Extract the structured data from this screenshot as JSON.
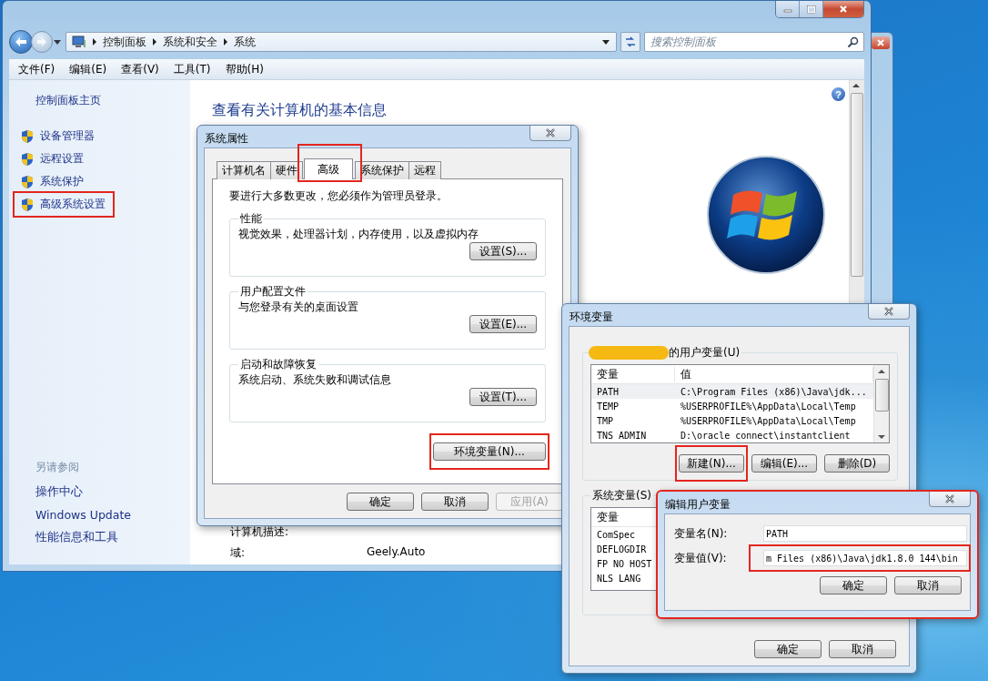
{
  "main_window": {
    "address_bar": {
      "breadcrumb": [
        "控制面板",
        "系统和安全",
        "系统"
      ],
      "search_placeholder": "搜索控制面板"
    },
    "menu": [
      "文件(F)",
      "编辑(E)",
      "查看(V)",
      "工具(T)",
      "帮助(H)"
    ],
    "sidebar": {
      "home": "控制面板主页",
      "items": [
        {
          "label": "设备管理器",
          "highlighted": false
        },
        {
          "label": "远程设置",
          "highlighted": false
        },
        {
          "label": "系统保护",
          "highlighted": false
        },
        {
          "label": "高级系统设置",
          "highlighted": true
        }
      ],
      "see_also_heading": "另请参阅",
      "see_also": [
        "操作中心",
        "Windows Update",
        "性能信息和工具"
      ]
    },
    "content": {
      "heading": "查看有关计算机的基本信息",
      "help_button": "?",
      "rows": [
        {
          "label": "计算机描述:"
        },
        {
          "label": "域:",
          "value": "Geely.Auto"
        }
      ]
    }
  },
  "system_properties": {
    "title": "系统属性",
    "tabs": [
      {
        "label": "计算机名",
        "selected": false,
        "highlighted": false
      },
      {
        "label": "硬件",
        "selected": false,
        "highlighted": false
      },
      {
        "label": "高级",
        "selected": true,
        "highlighted": true
      },
      {
        "label": "系统保护",
        "selected": false,
        "highlighted": false
      },
      {
        "label": "远程",
        "selected": false,
        "highlighted": false
      }
    ],
    "notice": "要进行大多数更改，您必须作为管理员登录。",
    "groups": [
      {
        "title": "性能",
        "description": "视觉效果，处理器计划，内存使用，以及虚拟内存",
        "button": "设置(S)..."
      },
      {
        "title": "用户配置文件",
        "description": "与您登录有关的桌面设置",
        "button": "设置(E)..."
      },
      {
        "title": "启动和故障恢复",
        "description": "系统启动、系统失败和调试信息",
        "button": "设置(T)..."
      }
    ],
    "env_button": {
      "label": "环境变量(N)...",
      "highlighted": true
    },
    "buttons": [
      {
        "label": "确定",
        "disabled": false
      },
      {
        "label": "取消",
        "disabled": false
      },
      {
        "label": "应用(A)",
        "disabled": true
      }
    ]
  },
  "environment_variables": {
    "title": "环境变量",
    "user_vars": {
      "title": "的用户变量(U)",
      "columns": [
        "变量",
        "值"
      ],
      "rows": [
        {
          "name": "PATH",
          "value": "C:\\Program Files (x86)\\Java\\jdk...",
          "selected": true
        },
        {
          "name": "TEMP",
          "value": "%USERPROFILE%\\AppData\\Local\\Temp",
          "selected": false
        },
        {
          "name": "TMP",
          "value": "%USERPROFILE%\\AppData\\Local\\Temp",
          "selected": false
        },
        {
          "name": "TNS_ADMIN",
          "value": "D:\\oracle_connect\\instantclient",
          "selected": false
        }
      ],
      "buttons": [
        {
          "label": "新建(N)...",
          "highlighted": true
        },
        {
          "label": "编辑(E)...",
          "highlighted": false
        },
        {
          "label": "删除(D)",
          "highlighted": false
        }
      ]
    },
    "system_vars": {
      "title": "系统变量(S)",
      "columns": [
        "变量"
      ],
      "rows": [
        {
          "name": "ComSpec"
        },
        {
          "name": "DEFLOGDIR"
        },
        {
          "name": "FP_NO_HOST_"
        },
        {
          "name": "NLS_LANG"
        }
      ]
    },
    "buttons": [
      "确定",
      "取消"
    ]
  },
  "edit_dialog": {
    "title": "编辑用户变量",
    "highlighted": true,
    "fields": [
      {
        "label": "变量名(N):",
        "value": "PATH",
        "highlighted": false
      },
      {
        "label": "变量值(V):",
        "value": "m Files (x86)\\Java\\jdk1.8.0_144\\bin",
        "highlighted": true
      }
    ],
    "buttons": [
      "确定",
      "取消"
    ]
  }
}
